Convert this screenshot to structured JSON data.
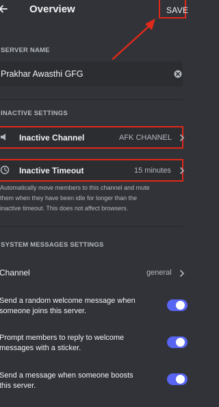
{
  "header": {
    "title": "Overview",
    "save_label": "SAVE"
  },
  "server_name": {
    "section_label": "SERVER NAME",
    "value": "Prakhar Awasthi GFG"
  },
  "inactive_settings": {
    "section_label": "INACTIVE SETTINGS",
    "channel": {
      "label": "Inactive Channel",
      "value": "AFK CHANNEL"
    },
    "timeout": {
      "label": "Inactive Timeout",
      "value": "15 minutes"
    },
    "helper_lines": [
      "Automatically move members to this channel and mute",
      "them when they have been idle for longer than the",
      "inactive timeout. This does not affect browsers."
    ]
  },
  "system_messages": {
    "section_label": "SYSTEM MESSAGES SETTINGS",
    "channel": {
      "label": "Channel",
      "value": "general"
    },
    "toggles": [
      {
        "lines": [
          "Send a random welcome message when",
          "someone joins this server."
        ],
        "enabled": true
      },
      {
        "lines": [
          "Prompt members to reply to welcome",
          "messages with a sticker."
        ],
        "enabled": true
      },
      {
        "lines": [
          "Send a message when someone boosts",
          "this server."
        ],
        "enabled": true
      }
    ]
  },
  "colors": {
    "background": "#313338",
    "field": "#2b2d31",
    "highlight": "#e0291a",
    "toggle_on": "#5865f2"
  }
}
